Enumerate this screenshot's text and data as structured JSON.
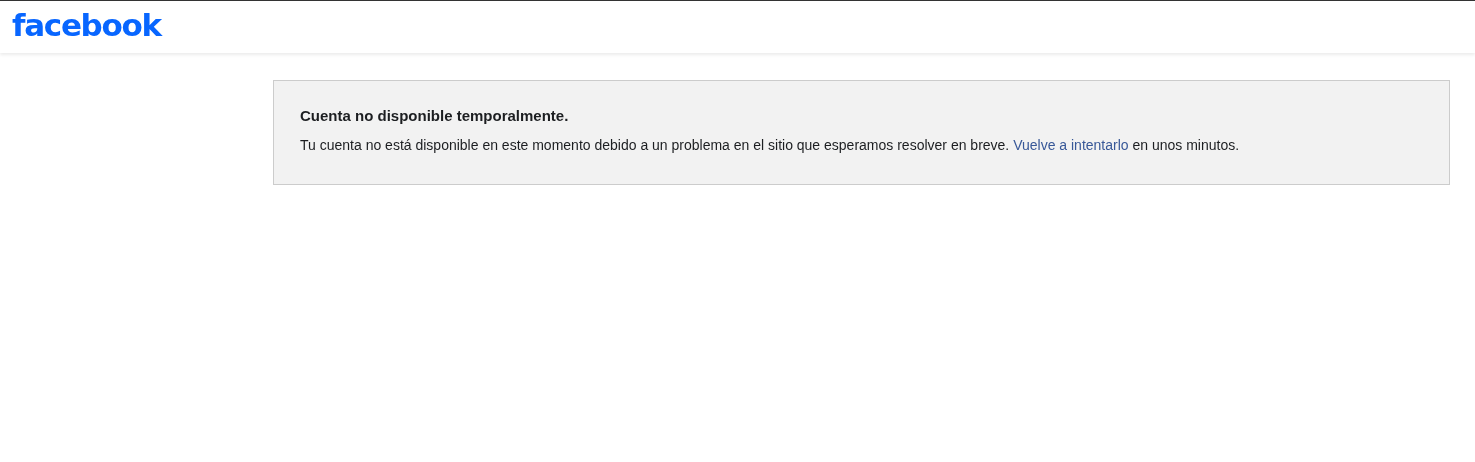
{
  "header": {
    "logo": "facebook"
  },
  "notice": {
    "title": "Cuenta no disponible temporalmente.",
    "message": {
      "before": "Tu cuenta no está disponible en este momento debido a un problema en el sitio que esperamos resolver en breve.",
      "link": "Vuelve a intentarlo",
      "after": "en unos minutos."
    }
  }
}
